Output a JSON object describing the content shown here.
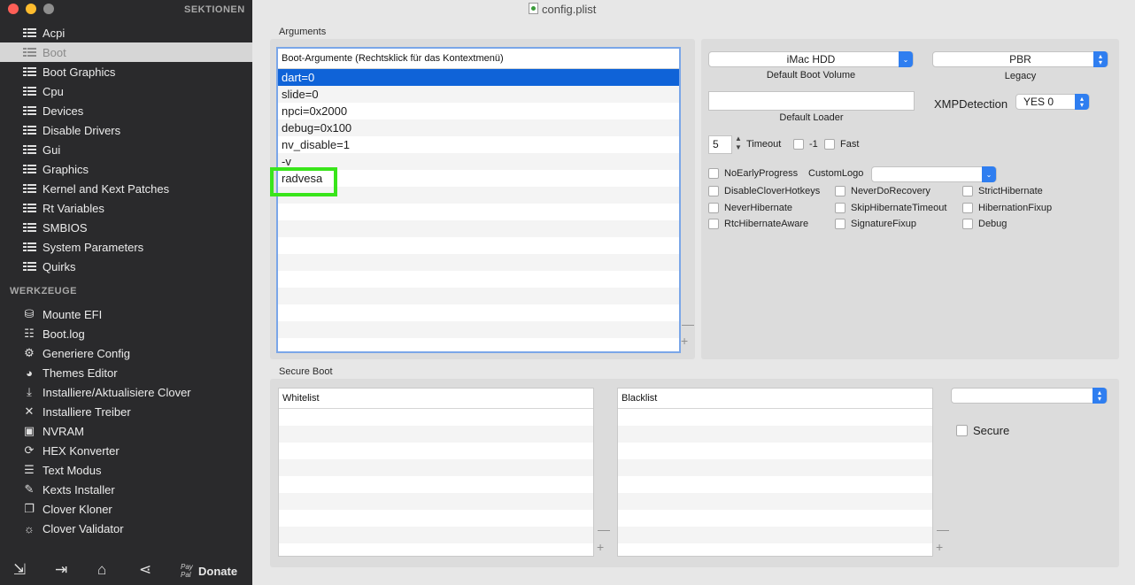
{
  "sidebar": {
    "section_header": "SEKTIONEN",
    "items": [
      {
        "label": "Acpi",
        "icon": "list-icon"
      },
      {
        "label": "Boot",
        "icon": "list-icon",
        "selected": true
      },
      {
        "label": "Boot Graphics",
        "icon": "list-icon"
      },
      {
        "label": "Cpu",
        "icon": "list-icon"
      },
      {
        "label": "Devices",
        "icon": "list-icon"
      },
      {
        "label": "Disable Drivers",
        "icon": "list-icon"
      },
      {
        "label": "Gui",
        "icon": "list-icon"
      },
      {
        "label": "Graphics",
        "icon": "list-icon"
      },
      {
        "label": "Kernel and Kext Patches",
        "icon": "list-icon"
      },
      {
        "label": "Rt Variables",
        "icon": "list-icon"
      },
      {
        "label": "SMBIOS",
        "icon": "list-icon"
      },
      {
        "label": "System Parameters",
        "icon": "list-icon"
      },
      {
        "label": "Quirks",
        "icon": "list-icon"
      }
    ],
    "tools_header": "WERKZEUGE",
    "tools": [
      {
        "label": "Mounte EFI",
        "icon": "disk-icon",
        "glyph": "⛁"
      },
      {
        "label": "Boot.log",
        "icon": "log-icon",
        "glyph": "☷"
      },
      {
        "label": "Generiere Config",
        "icon": "gears-icon",
        "glyph": "⚙"
      },
      {
        "label": "Themes Editor",
        "icon": "palette-icon",
        "glyph": "◕"
      },
      {
        "label": "Installiere/Aktualisiere Clover",
        "icon": "install-icon",
        "glyph": "⤓"
      },
      {
        "label": "Installiere Treiber",
        "icon": "tools-icon",
        "glyph": "✕"
      },
      {
        "label": "NVRAM",
        "icon": "chip-icon",
        "glyph": "▣"
      },
      {
        "label": "HEX Konverter",
        "icon": "convert-icon",
        "glyph": "⟳"
      },
      {
        "label": "Text Modus",
        "icon": "text-icon",
        "glyph": "☰"
      },
      {
        "label": "Kexts Installer",
        "icon": "plug-icon",
        "glyph": "✎"
      },
      {
        "label": "Clover Kloner",
        "icon": "clone-icon",
        "glyph": "❐"
      },
      {
        "label": "Clover Validator",
        "icon": "bulb-icon",
        "glyph": "☼"
      }
    ],
    "bottom": {
      "donate_label": "Donate",
      "paypal_text": "Pay Pal"
    }
  },
  "window": {
    "title": "config.plist"
  },
  "arguments": {
    "group_label": "Arguments",
    "table_header": "Boot-Argumente (Rechtsklick für das Kontextmenü)",
    "rows": [
      "dart=0",
      "slide=0",
      "npci=0x2000",
      "debug=0x100",
      "nv_disable=1",
      "-v",
      "radvesa"
    ],
    "selected_index": 0,
    "minus": "—",
    "plus": "+"
  },
  "options": {
    "default_boot_volume": {
      "value": "iMac HDD",
      "caption": "Default Boot Volume"
    },
    "legacy": {
      "value": "PBR",
      "caption": "Legacy"
    },
    "default_loader": {
      "value": "",
      "caption": "Default Loader"
    },
    "xmp": {
      "label": "XMPDetection",
      "value": "YES 0"
    },
    "timeout": {
      "value": "5",
      "label": "Timeout"
    },
    "minus_one_label": "-1",
    "fast_label": "Fast",
    "custom_logo_label": "CustomLogo",
    "custom_logo_value": "",
    "checkboxes": [
      "NoEarlyProgress",
      "DisableCloverHotkeys",
      "NeverDoRecovery",
      "StrictHibernate",
      "NeverHibernate",
      "SkipHibernateTimeout",
      "HibernationFixup",
      "RtcHibernateAware",
      "SignatureFixup",
      "Debug"
    ]
  },
  "secure_boot": {
    "group_label": "Secure Boot",
    "whitelist_header": "Whitelist",
    "blacklist_header": "Blacklist",
    "policy_value": "",
    "secure_label": "Secure",
    "minus": "—",
    "plus": "+"
  },
  "colors": {
    "selection": "#0f63d8",
    "highlight": "#39e51b",
    "sidebar": "#2a2a2c",
    "accent": "#2f7ef0"
  }
}
